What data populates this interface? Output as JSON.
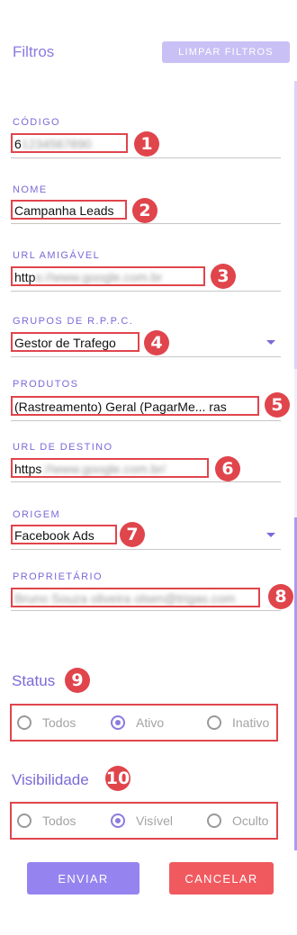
{
  "header": {
    "title": "Filtros",
    "clear_label": "LIMPAR FILTROS"
  },
  "fields": [
    {
      "label": "CÓDIGO",
      "value": "6",
      "blurred_suffix": "1234567890",
      "badge": "1"
    },
    {
      "label": "NOME",
      "value": "Campanha Leads",
      "blurred_suffix": "",
      "badge": "2"
    },
    {
      "label": "URL AMIGÁVEL",
      "value": "http",
      "blurred_suffix": "s://www.google.com.br",
      "badge": "3"
    },
    {
      "label": "GRUPOS DE R.P.P.C.",
      "value": "Gestor de Trafego",
      "blurred_suffix": "",
      "badge": "4"
    },
    {
      "label": "PRODUTOS",
      "value": "(Rastreamento) Geral (PagarMe... ras",
      "blurred_suffix": "",
      "badge": "5"
    },
    {
      "label": "URL DE DESTINO",
      "value": "https",
      "blurred_suffix": "://www.google.com.br/",
      "badge": "6"
    },
    {
      "label": "ORIGEM",
      "value": "Facebook Ads",
      "blurred_suffix": "",
      "badge": "7"
    },
    {
      "label": "PROPRIETÁRIO",
      "value": "",
      "blurred_suffix": "Bruno Souza oliveira olsen@trigas.com",
      "badge": "8"
    }
  ],
  "status": {
    "title": "Status",
    "badge": "9",
    "options": [
      "Todos",
      "Ativo",
      "Inativo"
    ],
    "selected": "Ativo"
  },
  "visibility": {
    "title": "Visibilidade",
    "badge": "10",
    "options": [
      "Todos",
      "Visível",
      "Oculto"
    ],
    "selected": "Visível"
  },
  "actions": {
    "send_label": "ENVIAR",
    "cancel_label": "CANCELAR"
  },
  "colors": {
    "accent": "#8b7ae0",
    "highlight": "#e0454c",
    "send": "#9584ef",
    "cancel": "#f05a5f"
  }
}
